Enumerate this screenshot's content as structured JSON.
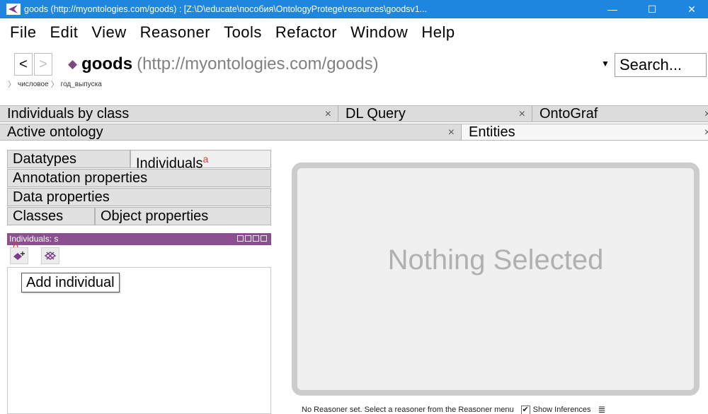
{
  "window": {
    "title": "goods (http://myontologies.com/goods) : [Z:\\D\\educate\\пособия\\OntologyProtege\\resources\\goodsv1...",
    "minimize": "—",
    "maximize": "☐",
    "close": "✕"
  },
  "menu": [
    "File",
    "Edit",
    "View",
    "Reasoner",
    "Tools",
    "Refactor",
    "Window",
    "Help"
  ],
  "nav": {
    "back": "<",
    "forward": ">",
    "ontology_name": "goods",
    "ontology_iri": "(http://myontologies.com/goods)",
    "search_label": "Search..."
  },
  "breadcrumb": [
    "числовое",
    "год_выпуска"
  ],
  "tabs_row1": [
    {
      "label": "Individuals by class",
      "close": "×"
    },
    {
      "label": "DL Query",
      "close": "×"
    },
    {
      "label": "OntoGraf",
      "close": "×"
    }
  ],
  "tabs_row2": [
    {
      "label": "Active ontology",
      "close": "×"
    },
    {
      "label": "Entities",
      "close": "×"
    }
  ],
  "entity_tabs": {
    "datatypes": "Datatypes",
    "individuals": "Individuals",
    "individuals_marker": "a",
    "annotation_properties": "Annotation properties",
    "data_properties": "Data properties",
    "classes": "Classes",
    "object_properties": "Object properties"
  },
  "individuals_view": {
    "header": "Individuals: s",
    "add_marker": "б",
    "tooltip": "Add individual"
  },
  "right_panel": {
    "placeholder": "Nothing Selected"
  },
  "status": {
    "reasoner_text": "No Reasoner set. Select a reasoner from the Reasoner menu",
    "show_inferences": "Show Inferences"
  },
  "colors": {
    "titlebar": "#1f86e0",
    "view_header": "#8a4f8f",
    "marker": "#e23a3a"
  }
}
